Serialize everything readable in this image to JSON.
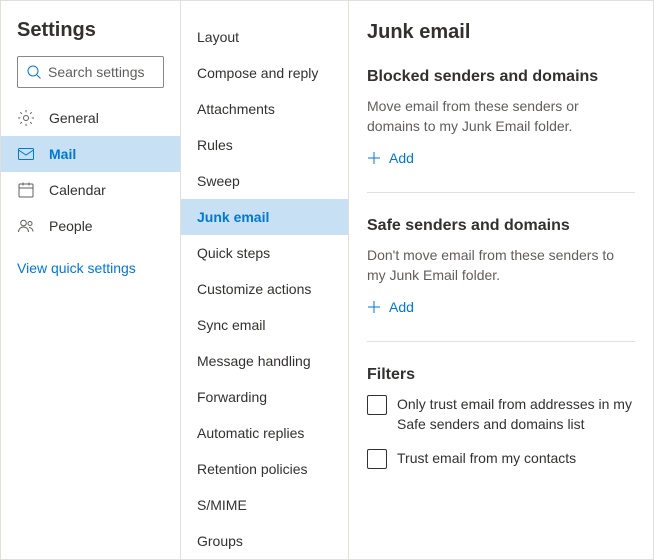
{
  "sidebar": {
    "title": "Settings",
    "search_placeholder": "Search settings",
    "items": [
      {
        "label": "General",
        "icon": "gear"
      },
      {
        "label": "Mail",
        "icon": "mail",
        "selected": true
      },
      {
        "label": "Calendar",
        "icon": "calendar"
      },
      {
        "label": "People",
        "icon": "people"
      }
    ],
    "quick_link": "View quick settings"
  },
  "submenu": {
    "items": [
      "Layout",
      "Compose and reply",
      "Attachments",
      "Rules",
      "Sweep",
      "Junk email",
      "Quick steps",
      "Customize actions",
      "Sync email",
      "Message handling",
      "Forwarding",
      "Automatic replies",
      "Retention policies",
      "S/MIME",
      "Groups"
    ],
    "selected_index": 5
  },
  "main": {
    "title": "Junk email",
    "blocked": {
      "title": "Blocked senders and domains",
      "desc": "Move email from these senders or domains to my Junk Email folder.",
      "add_label": "Add"
    },
    "safe": {
      "title": "Safe senders and domains",
      "desc": "Don't move email from these senders to my Junk Email folder.",
      "add_label": "Add"
    },
    "filters": {
      "title": "Filters",
      "opt1": "Only trust email from addresses in my Safe senders and domains list",
      "opt2": "Trust email from my contacts"
    }
  }
}
